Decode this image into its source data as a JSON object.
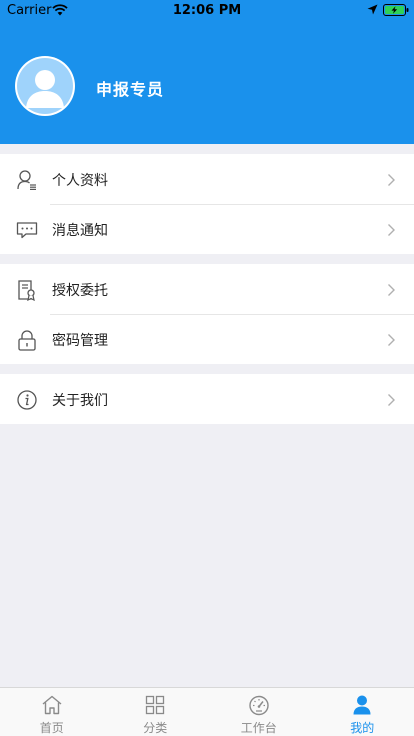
{
  "status_bar": {
    "carrier": "Carrier",
    "time": "12:06 PM"
  },
  "profile": {
    "name": "申报专员"
  },
  "menu": {
    "group1": [
      {
        "label": "个人资料",
        "icon": "user-profile-icon"
      },
      {
        "label": "消息通知",
        "icon": "message-icon"
      }
    ],
    "group2": [
      {
        "label": "授权委托",
        "icon": "authorization-document-icon"
      },
      {
        "label": "密码管理",
        "icon": "lock-icon"
      }
    ],
    "group3": [
      {
        "label": "关于我们",
        "icon": "info-icon"
      }
    ]
  },
  "tabs": [
    {
      "label": "首页",
      "icon": "home-icon",
      "active": false
    },
    {
      "label": "分类",
      "icon": "grid-icon",
      "active": false
    },
    {
      "label": "工作台",
      "icon": "dashboard-gauge-icon",
      "active": false
    },
    {
      "label": "我的",
      "icon": "person-icon",
      "active": true
    }
  ],
  "colors": {
    "accent": "#1a91ec",
    "background": "#efeff4",
    "text": "#222222",
    "inactive": "#8a8a8a"
  }
}
